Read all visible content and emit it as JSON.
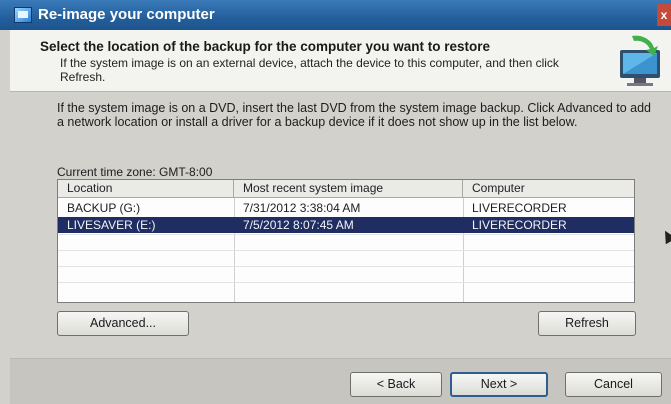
{
  "window": {
    "title": "Re-image your computer",
    "close_glyph": "x"
  },
  "header": {
    "heading": "Select the location of the backup for the computer you want to restore",
    "subtext": "If the system image is on an external device, attach the device to this computer, and then click Refresh."
  },
  "body": {
    "info": "If the system image is on a DVD, insert the last DVD from the system image backup. Click Advanced to add a network location or install a driver for a backup device if it does not show up in the list below.",
    "timezone": "Current time zone: GMT-8:00"
  },
  "table": {
    "columns": [
      "Location",
      "Most recent system image",
      "Computer"
    ],
    "rows": [
      {
        "location": "BACKUP (G:)",
        "image": "7/31/2012 3:38:04 AM",
        "computer": "LIVERECORDER",
        "selected": false
      },
      {
        "location": "LIVESAVER (E:)",
        "image": "7/5/2012 8:07:45 AM",
        "computer": "LIVERECORDER",
        "selected": true
      }
    ]
  },
  "buttons": {
    "advanced": "Advanced...",
    "refresh": "Refresh",
    "back": "< Back",
    "next": "Next >",
    "cancel": "Cancel"
  },
  "icons": {
    "app": "reimage-icon",
    "computer": "computer-monitor-icon",
    "cursor": "mouse-pointer-icon"
  }
}
